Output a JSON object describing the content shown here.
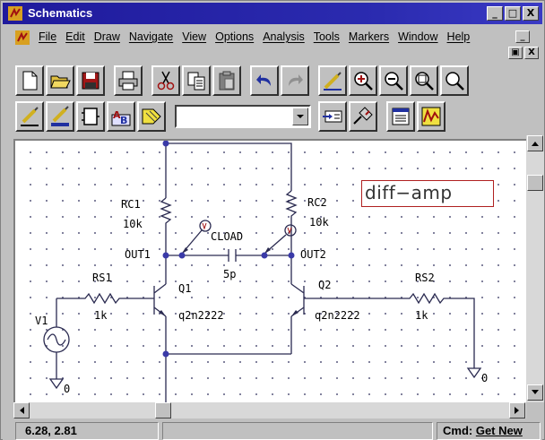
{
  "window": {
    "title": "Schematics"
  },
  "title_buttons": {
    "minimize": "_",
    "maximize": "□",
    "close": "X"
  },
  "menu": {
    "items": [
      "File",
      "Edit",
      "Draw",
      "Navigate",
      "View",
      "Options",
      "Analysis",
      "Tools",
      "Markers",
      "Window",
      "Help"
    ],
    "mdi_minimize": "_",
    "mdi_restore": "▣",
    "mdi_close": "X"
  },
  "toolbar1": [
    "new-icon",
    "open-icon",
    "save-icon",
    "print-icon",
    "cut-icon",
    "copy-icon",
    "paste-icon",
    "undo-icon",
    "redo-icon",
    "draw-wire-icon",
    "zoom-in-icon",
    "zoom-out-icon",
    "zoom-area-icon",
    "zoom-fit-icon"
  ],
  "toolbar2": [
    "draw-wire-icon",
    "draw-bus-icon",
    "draw-block-icon",
    "get-part-icon",
    "edit-attributes-icon",
    "part-combo",
    "setup-analysis-icon",
    "simulate-icon",
    "enable-bias-icon",
    "probe-icon"
  ],
  "part_combo": {
    "value": ""
  },
  "schematic": {
    "title_box": "diff−amp",
    "labels": {
      "rc1": "RC1",
      "rc1_val": "10k",
      "rc2": "RC2",
      "rc2_val": "10k",
      "cload": "CLOAD",
      "cload_val": "5p",
      "out1": "OUT1",
      "out2": "OUT2",
      "rs1": "RS1",
      "rs1_val": "1k",
      "rs2": "RS2",
      "rs2_val": "1k",
      "q1": "Q1",
      "q1_model": "q2n2222",
      "q2": "Q2",
      "q2_model": "q2n2222",
      "v1": "V1",
      "gnd1": "0",
      "gnd2": "0"
    }
  },
  "status": {
    "coords": "6.28,  2.81",
    "middle": "",
    "cmd_prefix": "Cmd: ",
    "cmd": "Get New"
  },
  "colors": {
    "wire": "#2a2a50",
    "node": "#3a3aa8",
    "title_bar": "#1f1a9c",
    "canvas": "#ffffff"
  }
}
